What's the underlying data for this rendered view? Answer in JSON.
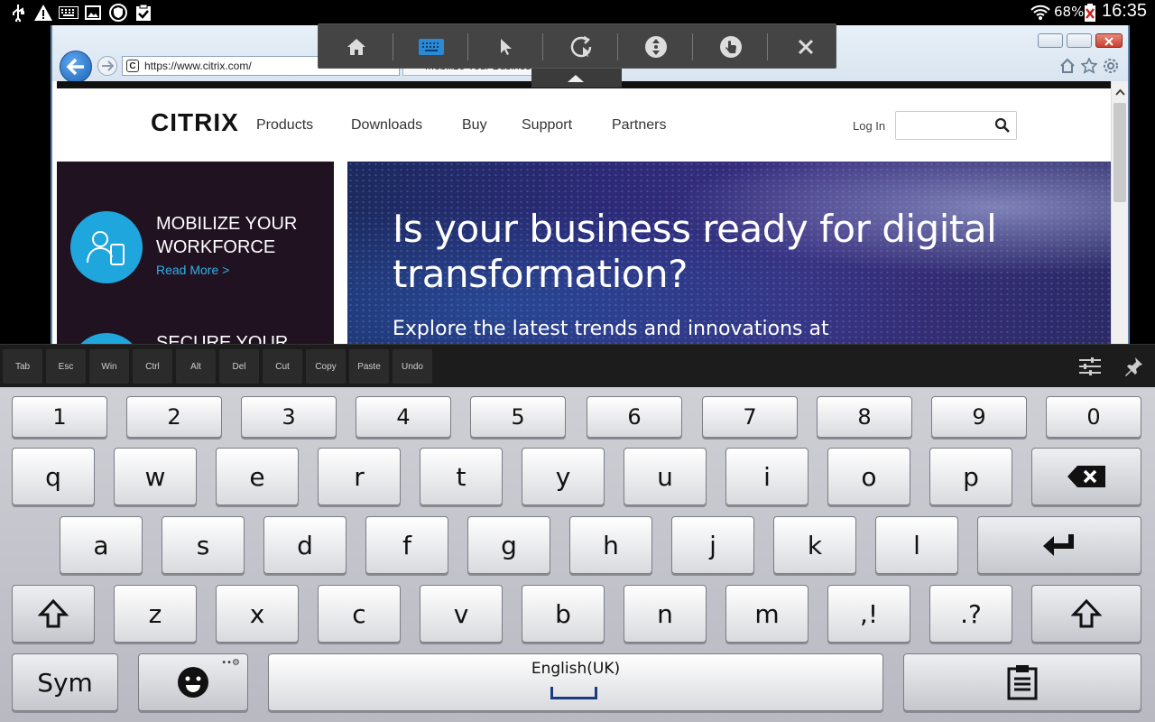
{
  "status_bar": {
    "battery_percent": "68%",
    "clock": "16:35",
    "icons": [
      "usb-icon",
      "warning-icon",
      "keyboard-icon",
      "picture-icon",
      "shield-icon",
      "clipboard-check-icon",
      "wifi-icon",
      "battery-icon"
    ]
  },
  "browser": {
    "address": "https://www.citrix.com/",
    "tab_title": "Mobilize Your Business...",
    "toolbar_icons": [
      "home-icon",
      "favorites-icon",
      "settings-icon"
    ]
  },
  "site": {
    "logo": "CITRIX",
    "nav": [
      "Products",
      "Downloads",
      "Buy",
      "Support",
      "Partners"
    ],
    "login": "Log In",
    "search_placeholder": "",
    "promo": {
      "title": "MOBILIZE YOUR WORKFORCE",
      "link": "Read More >",
      "title2": "SECURE YOUR"
    },
    "hero": {
      "title": "Is your business ready for digital transformation?",
      "subtitle": "Explore the latest trends and innovations at"
    }
  },
  "receiver_toolbar": {
    "buttons": [
      "home",
      "keyboard",
      "pointer",
      "gesture",
      "scroll",
      "touch",
      "close"
    ]
  },
  "extended_keys": [
    "Tab",
    "Esc",
    "Win",
    "Ctrl",
    "Alt",
    "Del",
    "Cut",
    "Copy",
    "Paste",
    "Undo"
  ],
  "keyboard": {
    "number_row": [
      "1",
      "2",
      "3",
      "4",
      "5",
      "6",
      "7",
      "8",
      "9",
      "0"
    ],
    "row1": [
      "q",
      "w",
      "e",
      "r",
      "t",
      "y",
      "u",
      "i",
      "o",
      "p"
    ],
    "row2": [
      "a",
      "s",
      "d",
      "f",
      "g",
      "h",
      "j",
      "k",
      "l"
    ],
    "row3": [
      "z",
      "x",
      "c",
      "v",
      "b",
      "n",
      "m"
    ],
    "comma_key": ",!",
    "period_key": ".?",
    "sym_label": "Sym",
    "space_label": "English(UK)"
  },
  "colors": {
    "accent": "#1fa6dc",
    "promo_bg": "#211222",
    "keyboard_bg": "#c4c5cc"
  }
}
